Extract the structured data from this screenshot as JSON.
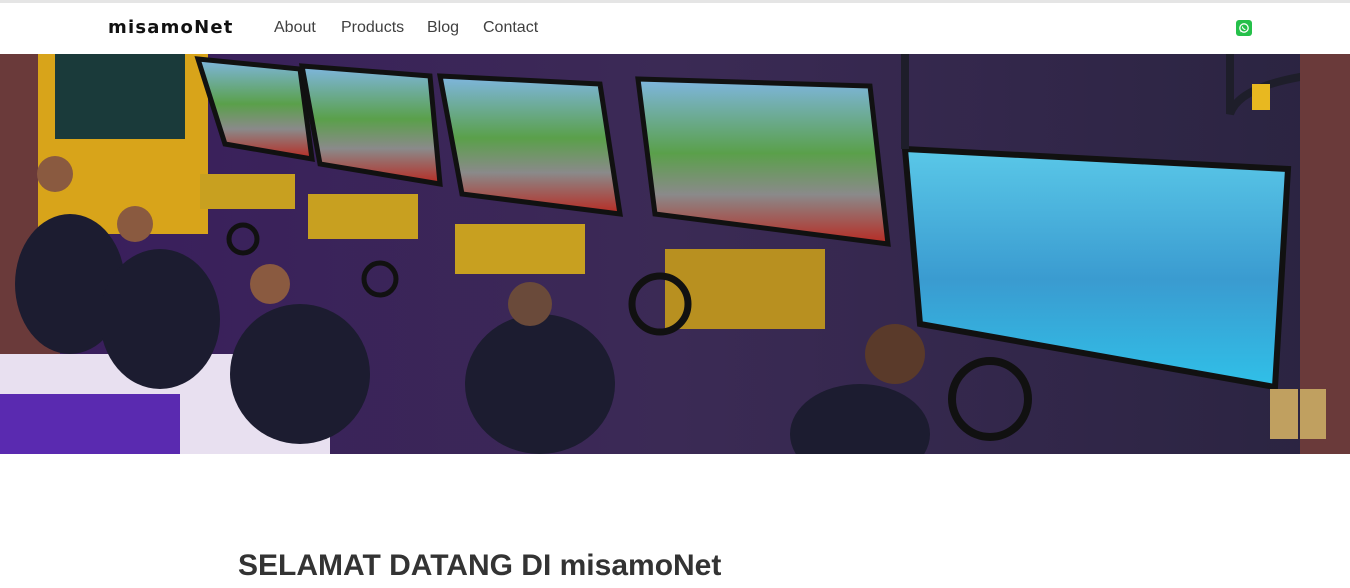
{
  "navbar": {
    "brand": "misamoNet",
    "links": [
      {
        "label": "About"
      },
      {
        "label": "Products"
      },
      {
        "label": "Blog"
      },
      {
        "label": "Contact"
      }
    ],
    "contact_icon": "whatsapp-icon"
  },
  "hero": {
    "image_subject": "sim racing gaming lounge with racing seats and large screens"
  },
  "main": {
    "heading": "SELAMAT DATANG DI misamoNet"
  },
  "colors": {
    "brand_text": "#111111",
    "nav_text": "#404040",
    "whatsapp": "#25c04a",
    "hero_purple": "#4a2a8a"
  }
}
